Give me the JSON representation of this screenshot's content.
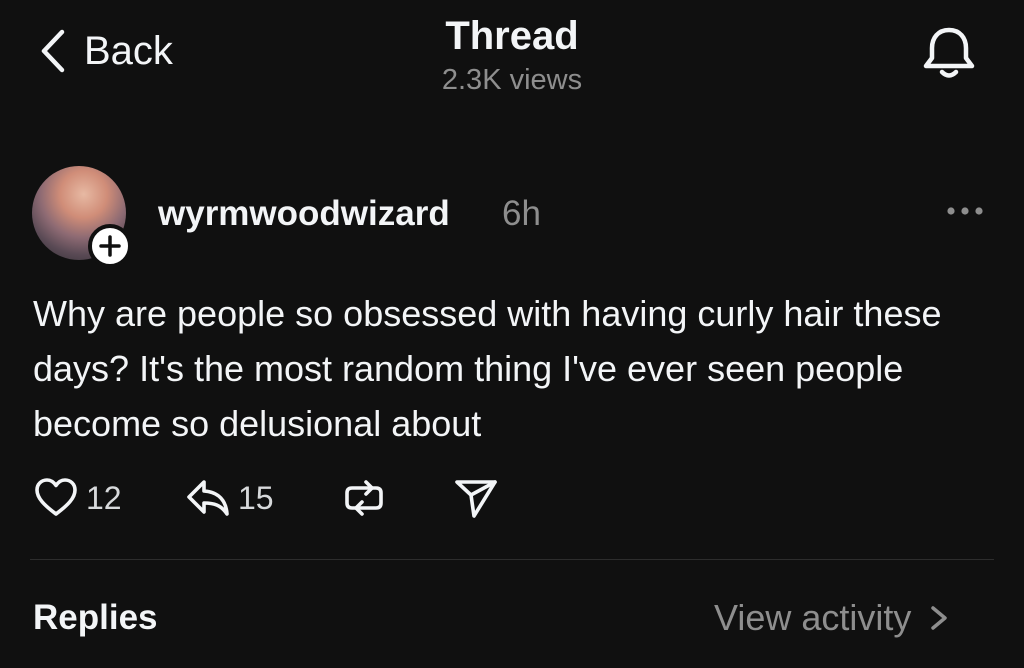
{
  "header": {
    "back_label": "Back",
    "title": "Thread",
    "views": "2.3K views"
  },
  "post": {
    "username": "wyrmwoodwizard",
    "time": "6h",
    "text": "Why are people so obsessed with having curly hair these days? It's the most random thing I've ever seen people become so delusional about",
    "likes": "12",
    "replies_count": "15"
  },
  "footer": {
    "replies_label": "Replies",
    "activity_label": "View activity"
  },
  "icons": {
    "back": "chevron-left-icon",
    "notification": "bell-icon",
    "follow": "plus-icon",
    "menu": "more-horizontal-icon",
    "like": "heart-icon",
    "reply": "reply-icon",
    "repost": "repost-icon",
    "share": "send-icon",
    "activity": "chevron-right-icon"
  },
  "colors": {
    "background": "#101010",
    "text": "#f3f5f7",
    "muted": "#8e8e8e"
  }
}
